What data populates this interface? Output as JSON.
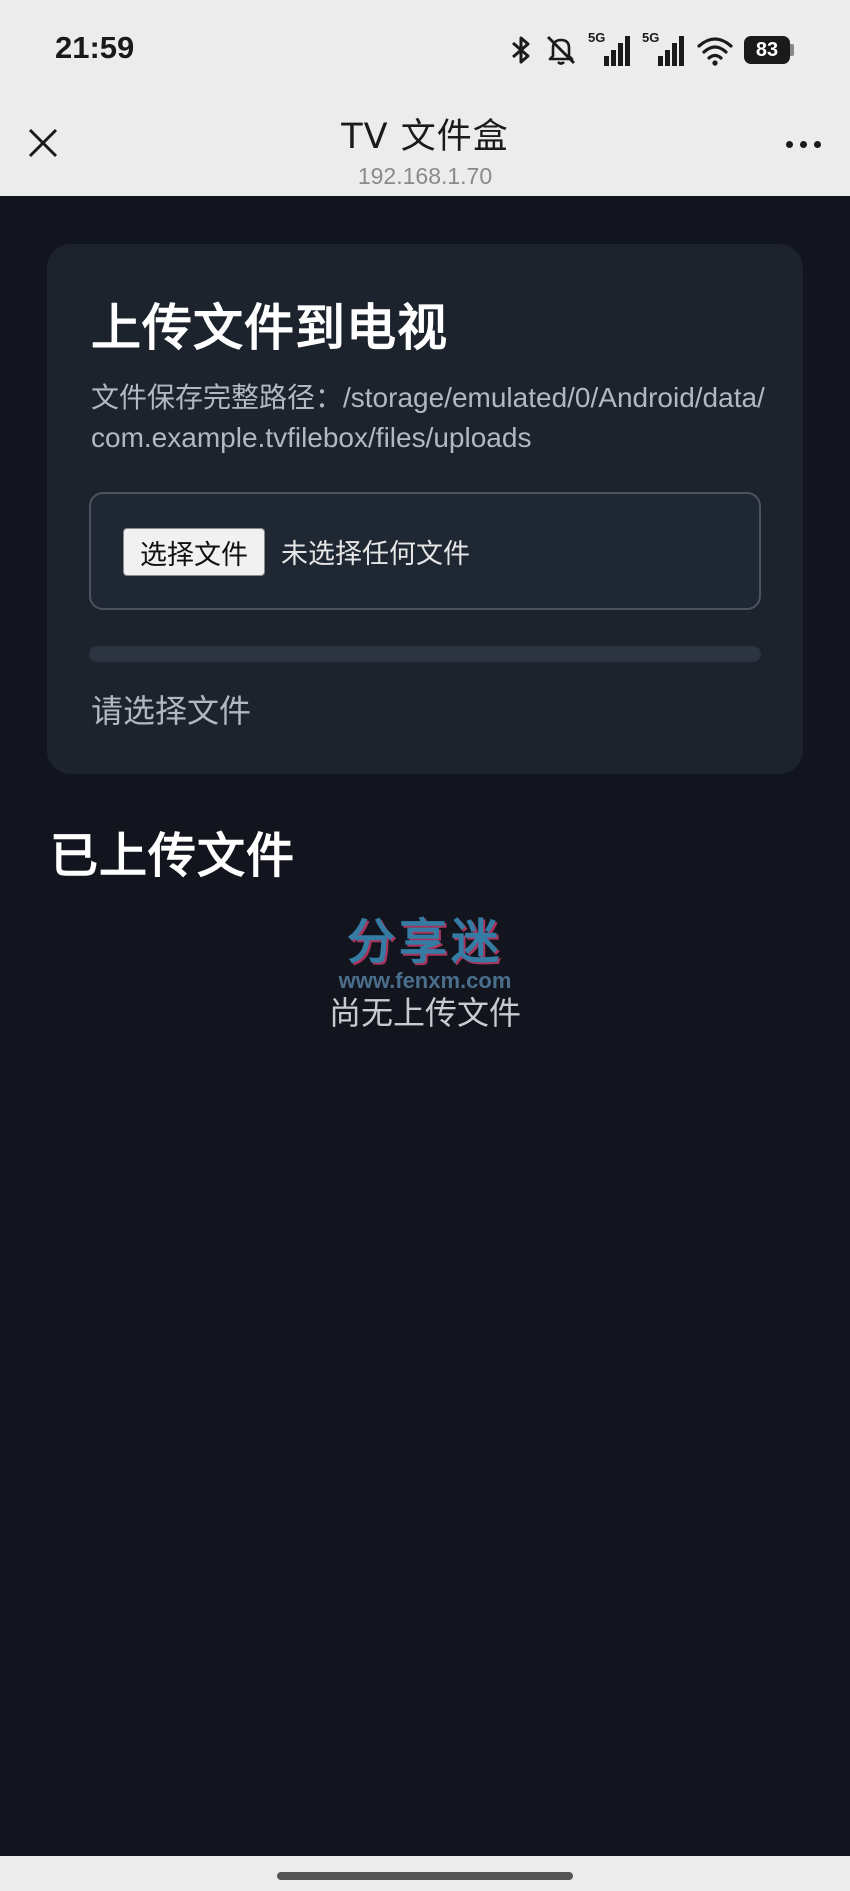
{
  "status_bar": {
    "time": "21:59",
    "icons": [
      "bluetooth-icon",
      "mute-icon",
      "signal-5g-icon",
      "signal-5g-icon",
      "wifi-icon",
      "battery-icon"
    ],
    "network_label_1": "5G",
    "network_label_2": "5G",
    "battery": "83"
  },
  "title_bar": {
    "title": "TV 文件盒",
    "subtitle": "192.168.1.70"
  },
  "upload_card": {
    "title": "上传文件到电视",
    "path_text": "文件保存完整路径：/storage/emulated/0/Android/data/com.example.tvfilebox/files/uploads",
    "choose_button": "选择文件",
    "file_status": "未选择任何文件",
    "progress": 0,
    "hint": "请选择文件"
  },
  "uploaded_section": {
    "title": "已上传文件",
    "empty_text": "尚无上传文件"
  },
  "watermark": {
    "big": "分享迷",
    "small": "www.fenxm.com"
  },
  "colors": {
    "background": "#12151d",
    "card": "#1c232d",
    "chrome": "#ececec"
  }
}
